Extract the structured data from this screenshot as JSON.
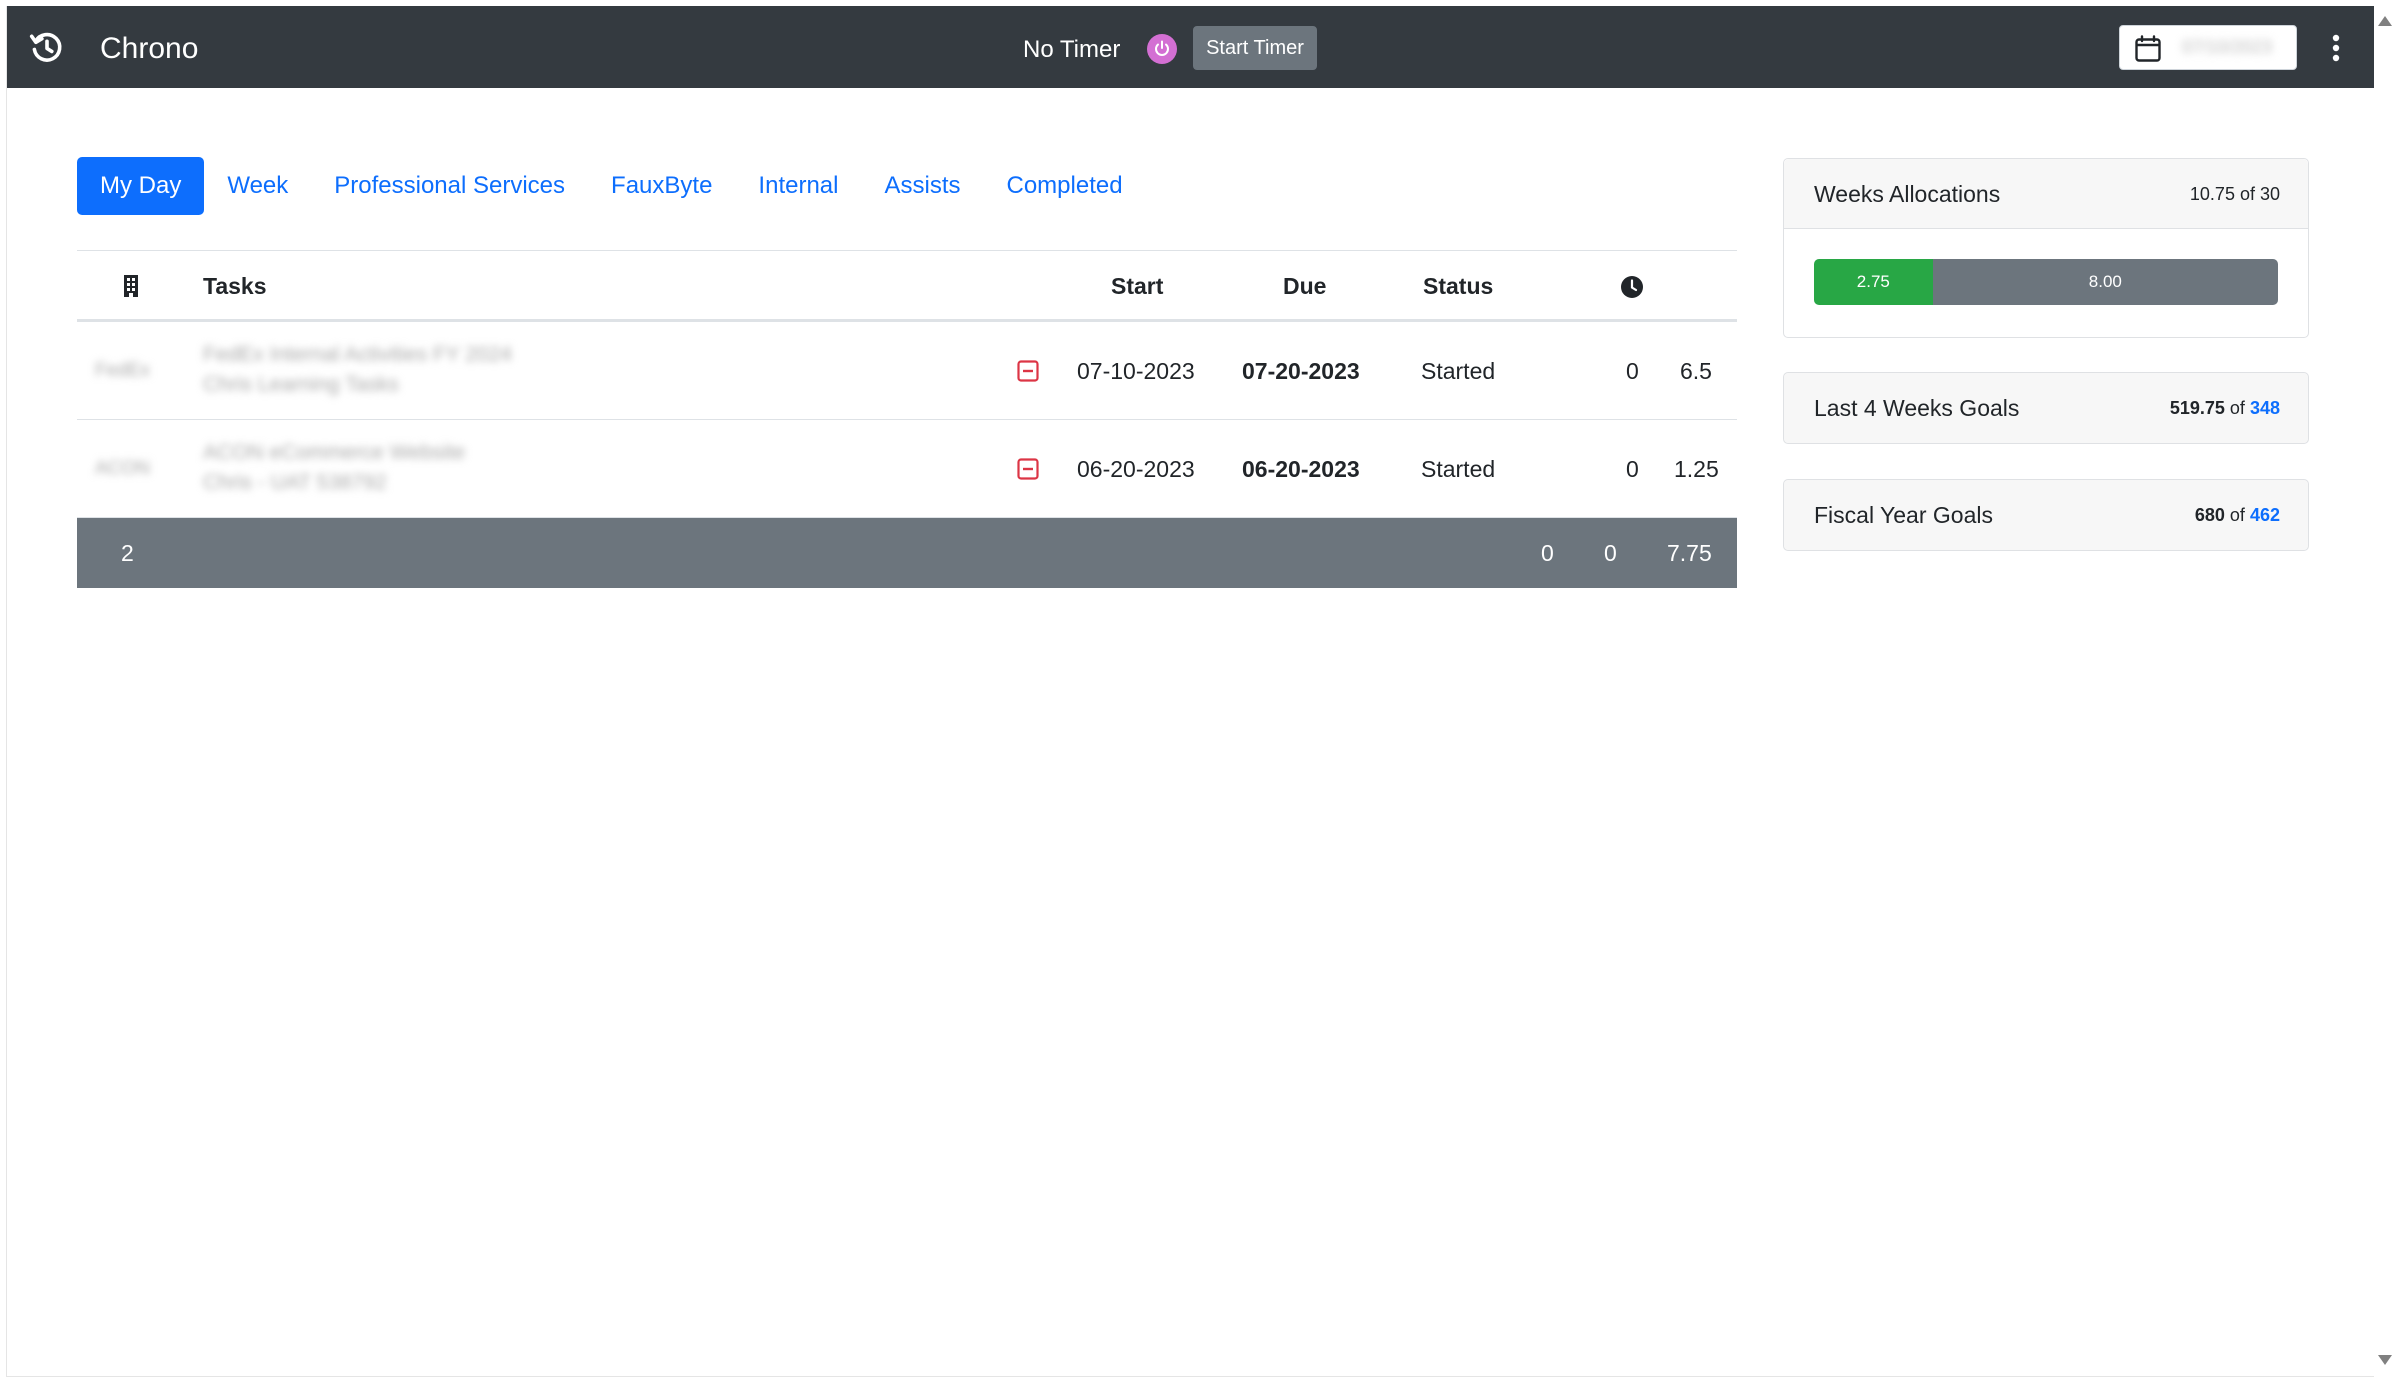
{
  "app": {
    "title": "Chrono"
  },
  "timer": {
    "status": "No Timer",
    "start_label": "Start Timer"
  },
  "date_picker": {
    "value": "07/10/2023"
  },
  "tabs": [
    {
      "label": "My Day",
      "active": true
    },
    {
      "label": "Week"
    },
    {
      "label": "Professional Services"
    },
    {
      "label": "FauxByte"
    },
    {
      "label": "Internal"
    },
    {
      "label": "Assists"
    },
    {
      "label": "Completed"
    }
  ],
  "table": {
    "headers": {
      "tasks": "Tasks",
      "start": "Start",
      "due": "Due",
      "status": "Status"
    },
    "rows": [
      {
        "client": "FedEx",
        "task_title": "FedEx Internal Activities FY 2024",
        "task_subtitle": "Chris Learning Tasks",
        "start": "07-10-2023",
        "due": "07-20-2023",
        "status": "Started",
        "timer": "0",
        "hours": "6.5"
      },
      {
        "client": "ACON",
        "task_title": "ACON eCommerce Website",
        "task_subtitle": "Chris - UAT 538792",
        "start": "06-20-2023",
        "due": "06-20-2023",
        "status": "Started",
        "timer": "0",
        "hours": "1.25"
      }
    ],
    "footer": {
      "count": "2",
      "col_a": "0",
      "col_b": "0",
      "total": "7.75"
    }
  },
  "weeks_allocations": {
    "title": "Weeks Allocations",
    "summary": "10.75 of 30",
    "segments": [
      {
        "label": "2.75",
        "value": 2.75,
        "color": "#28a745"
      },
      {
        "label": "8.00",
        "value": 8.0,
        "color": "#6c757d"
      }
    ]
  },
  "last_4_weeks": {
    "title": "Last 4 Weeks Goals",
    "value": "519.75",
    "of": "of",
    "goal": "348"
  },
  "fiscal_year": {
    "title": "Fiscal Year Goals",
    "value": "680",
    "of": "of",
    "goal": "462"
  }
}
